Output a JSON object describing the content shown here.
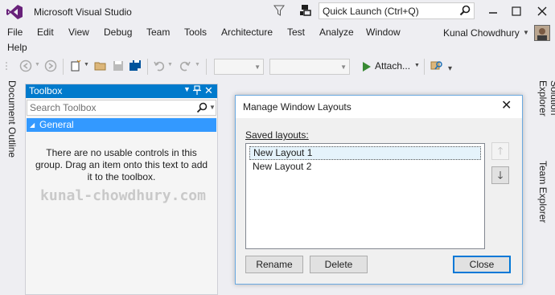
{
  "window": {
    "title": "Microsoft Visual Studio",
    "quick_launch_placeholder": "Quick Launch (Ctrl+Q)"
  },
  "menu": {
    "items": [
      "File",
      "Edit",
      "View",
      "Debug",
      "Team",
      "Tools",
      "Architecture",
      "Test",
      "Analyze",
      "Window",
      "Help"
    ],
    "user_name": "Kunal Chowdhury"
  },
  "toolbar": {
    "attach_label": "Attach..."
  },
  "side_tabs": {
    "left": "Document Outline",
    "right_1": "Solution Explorer",
    "right_2": "Team Explorer"
  },
  "toolbox": {
    "title": "Toolbox",
    "search_placeholder": "Search Toolbox",
    "group_label": "General",
    "empty_message": "There are no usable controls in this group. Drag an item onto this text to add it to the toolbox.",
    "watermark": "kunal-chowdhury.com"
  },
  "dialog": {
    "title": "Manage Window Layouts",
    "saved_label": "Saved layouts:",
    "layouts": [
      "New Layout 1",
      "New Layout 2"
    ],
    "selected_index": 0,
    "rename_label": "Rename",
    "delete_label": "Delete",
    "close_label": "Close"
  },
  "colors": {
    "accent": "#007acc",
    "selection": "#3399ff",
    "run_green": "#388a34"
  }
}
